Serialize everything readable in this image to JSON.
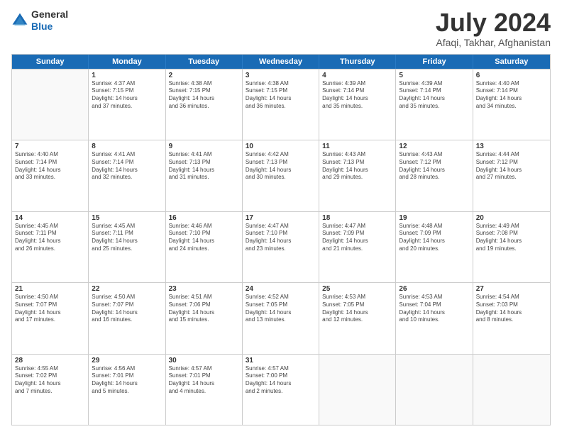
{
  "header": {
    "logo_line1": "General",
    "logo_line2": "Blue",
    "title": "July 2024",
    "location": "Afaqi, Takhar, Afghanistan"
  },
  "weekdays": [
    "Sunday",
    "Monday",
    "Tuesday",
    "Wednesday",
    "Thursday",
    "Friday",
    "Saturday"
  ],
  "weeks": [
    [
      {
        "day": "",
        "info": ""
      },
      {
        "day": "1",
        "info": "Sunrise: 4:37 AM\nSunset: 7:15 PM\nDaylight: 14 hours\nand 37 minutes."
      },
      {
        "day": "2",
        "info": "Sunrise: 4:38 AM\nSunset: 7:15 PM\nDaylight: 14 hours\nand 36 minutes."
      },
      {
        "day": "3",
        "info": "Sunrise: 4:38 AM\nSunset: 7:15 PM\nDaylight: 14 hours\nand 36 minutes."
      },
      {
        "day": "4",
        "info": "Sunrise: 4:39 AM\nSunset: 7:14 PM\nDaylight: 14 hours\nand 35 minutes."
      },
      {
        "day": "5",
        "info": "Sunrise: 4:39 AM\nSunset: 7:14 PM\nDaylight: 14 hours\nand 35 minutes."
      },
      {
        "day": "6",
        "info": "Sunrise: 4:40 AM\nSunset: 7:14 PM\nDaylight: 14 hours\nand 34 minutes."
      }
    ],
    [
      {
        "day": "7",
        "info": "Sunrise: 4:40 AM\nSunset: 7:14 PM\nDaylight: 14 hours\nand 33 minutes."
      },
      {
        "day": "8",
        "info": "Sunrise: 4:41 AM\nSunset: 7:14 PM\nDaylight: 14 hours\nand 32 minutes."
      },
      {
        "day": "9",
        "info": "Sunrise: 4:41 AM\nSunset: 7:13 PM\nDaylight: 14 hours\nand 31 minutes."
      },
      {
        "day": "10",
        "info": "Sunrise: 4:42 AM\nSunset: 7:13 PM\nDaylight: 14 hours\nand 30 minutes."
      },
      {
        "day": "11",
        "info": "Sunrise: 4:43 AM\nSunset: 7:13 PM\nDaylight: 14 hours\nand 29 minutes."
      },
      {
        "day": "12",
        "info": "Sunrise: 4:43 AM\nSunset: 7:12 PM\nDaylight: 14 hours\nand 28 minutes."
      },
      {
        "day": "13",
        "info": "Sunrise: 4:44 AM\nSunset: 7:12 PM\nDaylight: 14 hours\nand 27 minutes."
      }
    ],
    [
      {
        "day": "14",
        "info": "Sunrise: 4:45 AM\nSunset: 7:11 PM\nDaylight: 14 hours\nand 26 minutes."
      },
      {
        "day": "15",
        "info": "Sunrise: 4:45 AM\nSunset: 7:11 PM\nDaylight: 14 hours\nand 25 minutes."
      },
      {
        "day": "16",
        "info": "Sunrise: 4:46 AM\nSunset: 7:10 PM\nDaylight: 14 hours\nand 24 minutes."
      },
      {
        "day": "17",
        "info": "Sunrise: 4:47 AM\nSunset: 7:10 PM\nDaylight: 14 hours\nand 23 minutes."
      },
      {
        "day": "18",
        "info": "Sunrise: 4:47 AM\nSunset: 7:09 PM\nDaylight: 14 hours\nand 21 minutes."
      },
      {
        "day": "19",
        "info": "Sunrise: 4:48 AM\nSunset: 7:09 PM\nDaylight: 14 hours\nand 20 minutes."
      },
      {
        "day": "20",
        "info": "Sunrise: 4:49 AM\nSunset: 7:08 PM\nDaylight: 14 hours\nand 19 minutes."
      }
    ],
    [
      {
        "day": "21",
        "info": "Sunrise: 4:50 AM\nSunset: 7:07 PM\nDaylight: 14 hours\nand 17 minutes."
      },
      {
        "day": "22",
        "info": "Sunrise: 4:50 AM\nSunset: 7:07 PM\nDaylight: 14 hours\nand 16 minutes."
      },
      {
        "day": "23",
        "info": "Sunrise: 4:51 AM\nSunset: 7:06 PM\nDaylight: 14 hours\nand 15 minutes."
      },
      {
        "day": "24",
        "info": "Sunrise: 4:52 AM\nSunset: 7:05 PM\nDaylight: 14 hours\nand 13 minutes."
      },
      {
        "day": "25",
        "info": "Sunrise: 4:53 AM\nSunset: 7:05 PM\nDaylight: 14 hours\nand 12 minutes."
      },
      {
        "day": "26",
        "info": "Sunrise: 4:53 AM\nSunset: 7:04 PM\nDaylight: 14 hours\nand 10 minutes."
      },
      {
        "day": "27",
        "info": "Sunrise: 4:54 AM\nSunset: 7:03 PM\nDaylight: 14 hours\nand 8 minutes."
      }
    ],
    [
      {
        "day": "28",
        "info": "Sunrise: 4:55 AM\nSunset: 7:02 PM\nDaylight: 14 hours\nand 7 minutes."
      },
      {
        "day": "29",
        "info": "Sunrise: 4:56 AM\nSunset: 7:01 PM\nDaylight: 14 hours\nand 5 minutes."
      },
      {
        "day": "30",
        "info": "Sunrise: 4:57 AM\nSunset: 7:01 PM\nDaylight: 14 hours\nand 4 minutes."
      },
      {
        "day": "31",
        "info": "Sunrise: 4:57 AM\nSunset: 7:00 PM\nDaylight: 14 hours\nand 2 minutes."
      },
      {
        "day": "",
        "info": ""
      },
      {
        "day": "",
        "info": ""
      },
      {
        "day": "",
        "info": ""
      }
    ]
  ]
}
